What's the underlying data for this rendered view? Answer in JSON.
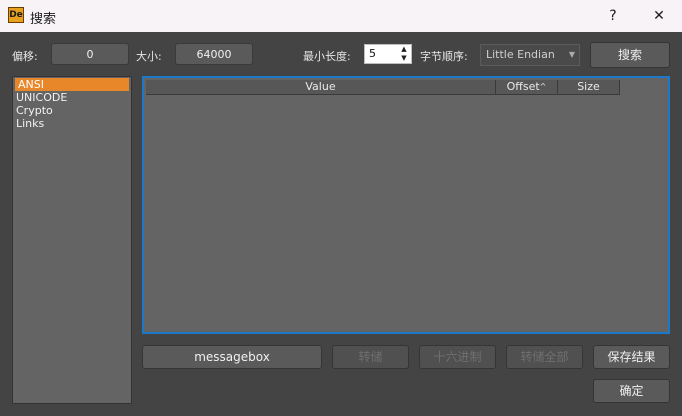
{
  "window": {
    "title": "搜索",
    "help_glyph": "?",
    "close_glyph": "✕",
    "app_icon_text": "De"
  },
  "toolbar": {
    "offset_label": "偏移:",
    "offset_value": "0",
    "size_label": "大小:",
    "size_value": "64000",
    "min_length_label": "最小长度:",
    "min_length_value": "5",
    "byte_order_label": "字节顺序:",
    "byte_order_value": "Little Endian",
    "search_button": "搜索"
  },
  "categories": [
    {
      "label": "ANSI",
      "selected": true
    },
    {
      "label": "UNICODE",
      "selected": false
    },
    {
      "label": "Crypto",
      "selected": false
    },
    {
      "label": "Links",
      "selected": false
    }
  ],
  "table": {
    "columns": [
      "Value",
      "Offset",
      "Size"
    ],
    "sort_column": "Offset",
    "rows": []
  },
  "buttons": {
    "messagebox": "messagebox",
    "goto": "转储",
    "hex": "十六进制",
    "goto_all": "转储全部",
    "save_results": "保存结果",
    "ok": "确定"
  },
  "colors": {
    "accent": "#e8862a",
    "focus_border": "#1e78c8"
  }
}
